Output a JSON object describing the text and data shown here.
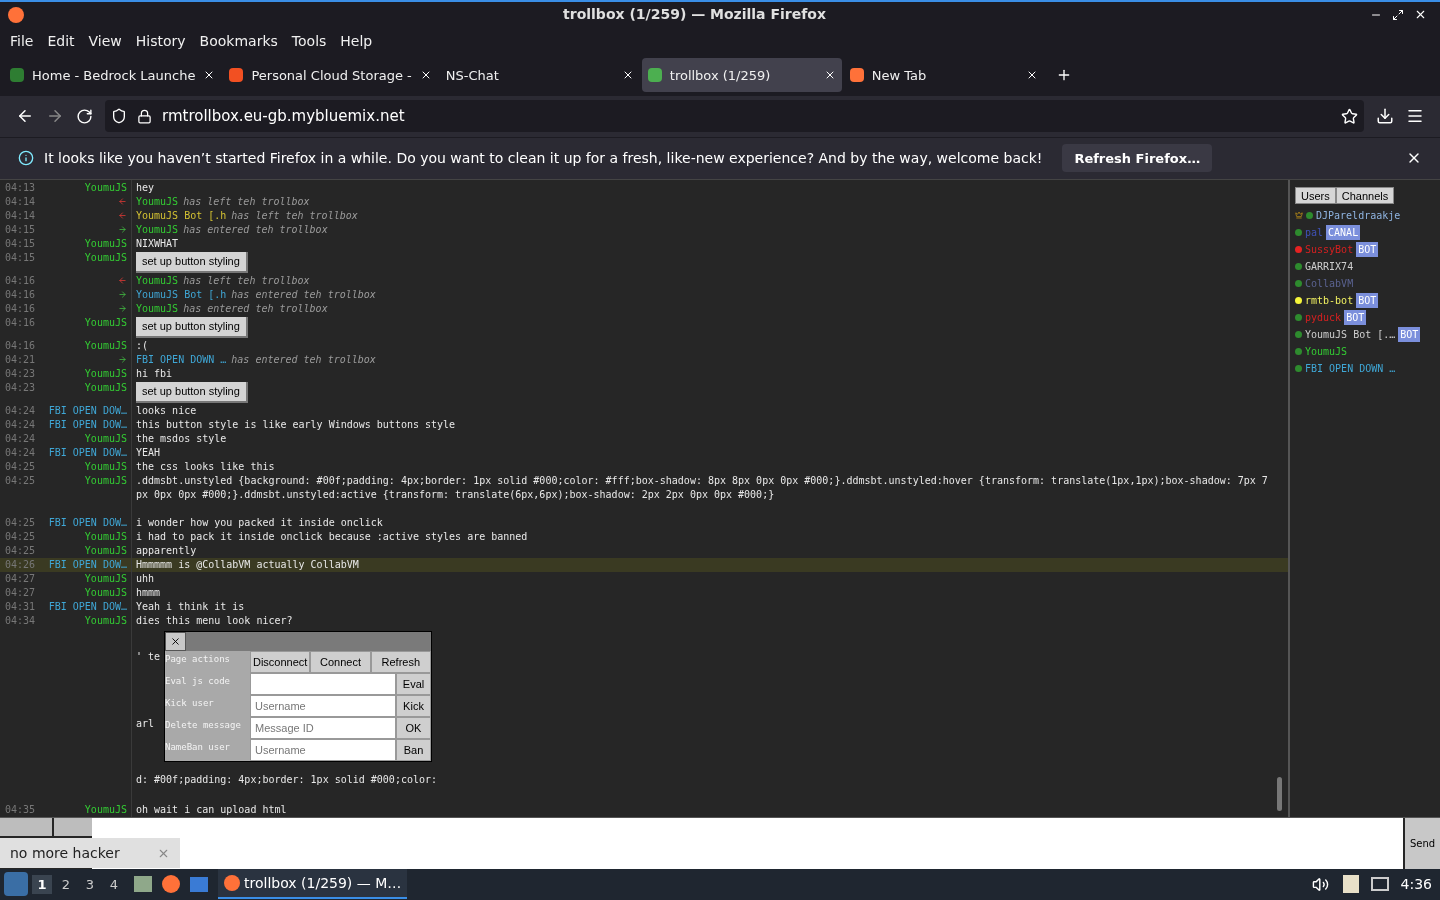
{
  "window": {
    "title": "trollbox (1/259) — Mozilla Firefox"
  },
  "menu": [
    "File",
    "Edit",
    "View",
    "History",
    "Bookmarks",
    "Tools",
    "Help"
  ],
  "tabs": [
    {
      "label": "Home - Bedrock Launche",
      "selected": false,
      "icon": true,
      "color": "#2e7d32"
    },
    {
      "label": "Personal Cloud Storage -",
      "selected": false,
      "icon": true,
      "color": "#f25022"
    },
    {
      "label": "NS-Chat",
      "selected": false,
      "icon": false
    },
    {
      "label": "trollbox (1/259)",
      "selected": true,
      "icon": true,
      "color": "#4caf50"
    },
    {
      "label": "New Tab",
      "selected": false,
      "icon": true,
      "color": "#ff7139"
    }
  ],
  "url": "rmtrollbox.eu-gb.mybluemix.net",
  "notification": {
    "text": "It looks like you haven’t started Firefox in a while. Do you want to clean it up for a fresh, like-new experience? And by the way, welcome back!",
    "button": "Refresh Firefox…"
  },
  "messages": [
    {
      "time": "04:13",
      "user": "YoumuJS",
      "color": "#33cc33",
      "kind": "msg",
      "text": "hey"
    },
    {
      "time": "04:14",
      "user": "YoumuJS",
      "color": "#33cc33",
      "kind": "leave",
      "text": "has left teh trollbox"
    },
    {
      "time": "04:14",
      "user": "YoumuJS Bot [.h",
      "color": "#d4c232",
      "kind": "leave",
      "text": "has left teh trollbox"
    },
    {
      "time": "04:15",
      "user": "YoumuJS",
      "color": "#33cc33",
      "kind": "join",
      "text": "has entered teh trollbox"
    },
    {
      "time": "04:15",
      "user": "YoumuJS",
      "color": "#33cc33",
      "kind": "msg",
      "text": "NIXWHAT"
    },
    {
      "time": "04:15",
      "user": "YoumuJS",
      "color": "#33cc33",
      "kind": "button",
      "text": "set up button styling"
    },
    {
      "time": "04:16",
      "user": "YoumuJS",
      "color": "#33cc33",
      "kind": "leave",
      "text": "has left teh trollbox"
    },
    {
      "time": "04:16",
      "user": "YoumuJS Bot [.h",
      "color": "#3fa7d6",
      "kind": "join",
      "text": "has entered teh trollbox"
    },
    {
      "time": "04:16",
      "user": "YoumuJS",
      "color": "#33cc33",
      "kind": "join",
      "text": "has entered teh trollbox"
    },
    {
      "time": "04:16",
      "user": "YoumuJS",
      "color": "#33cc33",
      "kind": "button",
      "text": "set up button styling"
    },
    {
      "time": "04:16",
      "user": "YoumuJS",
      "color": "#33cc33",
      "kind": "msg",
      "text": ":("
    },
    {
      "time": "04:21",
      "user": "FBI OPEN DOWN …",
      "color": "#3fa7d6",
      "kind": "join",
      "text": "has entered teh trollbox"
    },
    {
      "time": "04:23",
      "user": "YoumuJS",
      "color": "#33cc33",
      "kind": "msg",
      "text": "hi fbi"
    },
    {
      "time": "04:23",
      "user": "YoumuJS",
      "color": "#33cc33",
      "kind": "button",
      "text": "set up button styling"
    },
    {
      "time": "04:24",
      "user": "FBI OPEN DOW…",
      "color": "#3fa7d6",
      "kind": "msg",
      "text": "looks nice"
    },
    {
      "time": "04:24",
      "user": "FBI OPEN DOW…",
      "color": "#3fa7d6",
      "kind": "msg",
      "text": "this button style is like early Windows buttons style"
    },
    {
      "time": "04:24",
      "user": "YoumuJS",
      "color": "#33cc33",
      "kind": "msg",
      "text": "the msdos style"
    },
    {
      "time": "04:24",
      "user": "FBI OPEN DOW…",
      "color": "#3fa7d6",
      "kind": "msg",
      "text": "YEAH"
    },
    {
      "time": "04:25",
      "user": "YoumuJS",
      "color": "#33cc33",
      "kind": "msg",
      "text": "the css looks like this"
    },
    {
      "time": "04:25",
      "user": "YoumuJS",
      "color": "#33cc33",
      "kind": "msg",
      "text": ".ddmsbt.unstyled {background: #00f;padding: 4px;border: 1px solid #000;color: #fff;box-shadow: 8px 8px 0px 0px #000;}.ddmsbt.unstyled:hover {transform: translate(1px,1px);box-shadow: 7px 7px 0px 0px #000;}.ddmsbt.unstyled:active {transform: translate(6px,6px);box-shadow: 2px 2px 0px 0px #000;}"
    },
    {
      "time": "04:25",
      "user": "FBI OPEN DOW…",
      "color": "#3fa7d6",
      "kind": "msg",
      "text": "i wonder how you packed it inside onclick"
    },
    {
      "time": "04:25",
      "user": "YoumuJS",
      "color": "#33cc33",
      "kind": "msg",
      "text": "i had to pack it inside onclick because :active styles are banned"
    },
    {
      "time": "04:25",
      "user": "YoumuJS",
      "color": "#33cc33",
      "kind": "msg",
      "text": "apparently"
    },
    {
      "time": "04:26",
      "user": "FBI OPEN DOW…",
      "color": "#3fa7d6",
      "kind": "msg",
      "text": "Hmmmmm is @CollabVM actually CollabVM",
      "highlighted": true
    },
    {
      "time": "04:27",
      "user": "YoumuJS",
      "color": "#33cc33",
      "kind": "msg",
      "text": "uhh"
    },
    {
      "time": "04:27",
      "user": "YoumuJS",
      "color": "#33cc33",
      "kind": "msg",
      "text": "hmmm"
    },
    {
      "time": "04:31",
      "user": "FBI OPEN DOW…",
      "color": "#3fa7d6",
      "kind": "msg",
      "text": "Yeah i think it is"
    },
    {
      "time": "04:34",
      "user": "YoumuJS",
      "color": "#33cc33",
      "kind": "msg",
      "text": "dies this menu look nicer?"
    }
  ],
  "covered_lines": [
    "' te",
    "arl",
    "d: #00f;padding: 4px;border: 1px solid #000;color:"
  ],
  "last_message": {
    "time": "04:35",
    "user": "YoumuJS",
    "color": "#33cc33",
    "kind": "msg",
    "text": "oh wait i can upload html"
  },
  "admin_menu": {
    "rows": [
      {
        "label": "Page actions",
        "kind": "buttons",
        "buttons": [
          "Disconnect",
          "Connect",
          "Refresh"
        ]
      },
      {
        "label": "Eval js code",
        "kind": "field",
        "button": "Eval"
      },
      {
        "label": "Kick user",
        "kind": "field",
        "placeholder": "Username",
        "button": "Kick"
      },
      {
        "label": "Delete message",
        "kind": "field",
        "placeholder": "Message ID",
        "button": "OK"
      },
      {
        "label": "NameBan user",
        "kind": "field",
        "placeholder": "Username",
        "button": "Ban"
      }
    ]
  },
  "sidebar": {
    "tabs": [
      "Users",
      "Channels"
    ],
    "users": [
      {
        "name": {
          "text": "DJPareldraakje",
          "color": "#8fb4e0"
        },
        "color": "#2e8b2e",
        "crown": true
      },
      {
        "name": {
          "text": "pal",
          "color": "#3f51b5"
        },
        "color": "#2e8b2e",
        "badge": "CANAL"
      },
      {
        "name": {
          "text": "SussyBot",
          "color": "#d42020"
        },
        "color": "#e52222",
        "badge": "BOT"
      },
      {
        "name": {
          "text": "GARRIX74",
          "color": "#cfcfcf"
        },
        "color": "#2e8b2e"
      },
      {
        "name": {
          "text": "CollabVM",
          "color": "#5a6290"
        },
        "color": "#2e8b2e"
      },
      {
        "name": {
          "text": "rmtb-bot",
          "color": "#f0f060"
        },
        "color": "#f5f53a",
        "badge": "BOT"
      },
      {
        "name": {
          "text": "pyduck",
          "color": "#d42020"
        },
        "color": "#2e8b2e",
        "badge": "BOT"
      },
      {
        "name": {
          "text": "YoumuJS Bot [.…",
          "color": "#cfcfcf"
        },
        "color": "#2e8b2e",
        "badge": "BOT"
      },
      {
        "name": {
          "text": "YoumuJS",
          "color": "#33cc33"
        },
        "color": "#2e8b2e"
      },
      {
        "name": {
          "text": "FBI OPEN DOWN …",
          "color": "#3fa7d6"
        },
        "color": "#2e8b2e"
      }
    ]
  },
  "send_button": "Send",
  "autocomplete": "no more hacker",
  "taskbar": {
    "workspaces": [
      {
        "label": "1",
        "selected": true
      },
      {
        "label": "2",
        "selected": false
      },
      {
        "label": "3",
        "selected": false
      },
      {
        "label": "4",
        "selected": false
      }
    ],
    "task": "trollbox (1/259) — M…",
    "clock": "4:36"
  }
}
